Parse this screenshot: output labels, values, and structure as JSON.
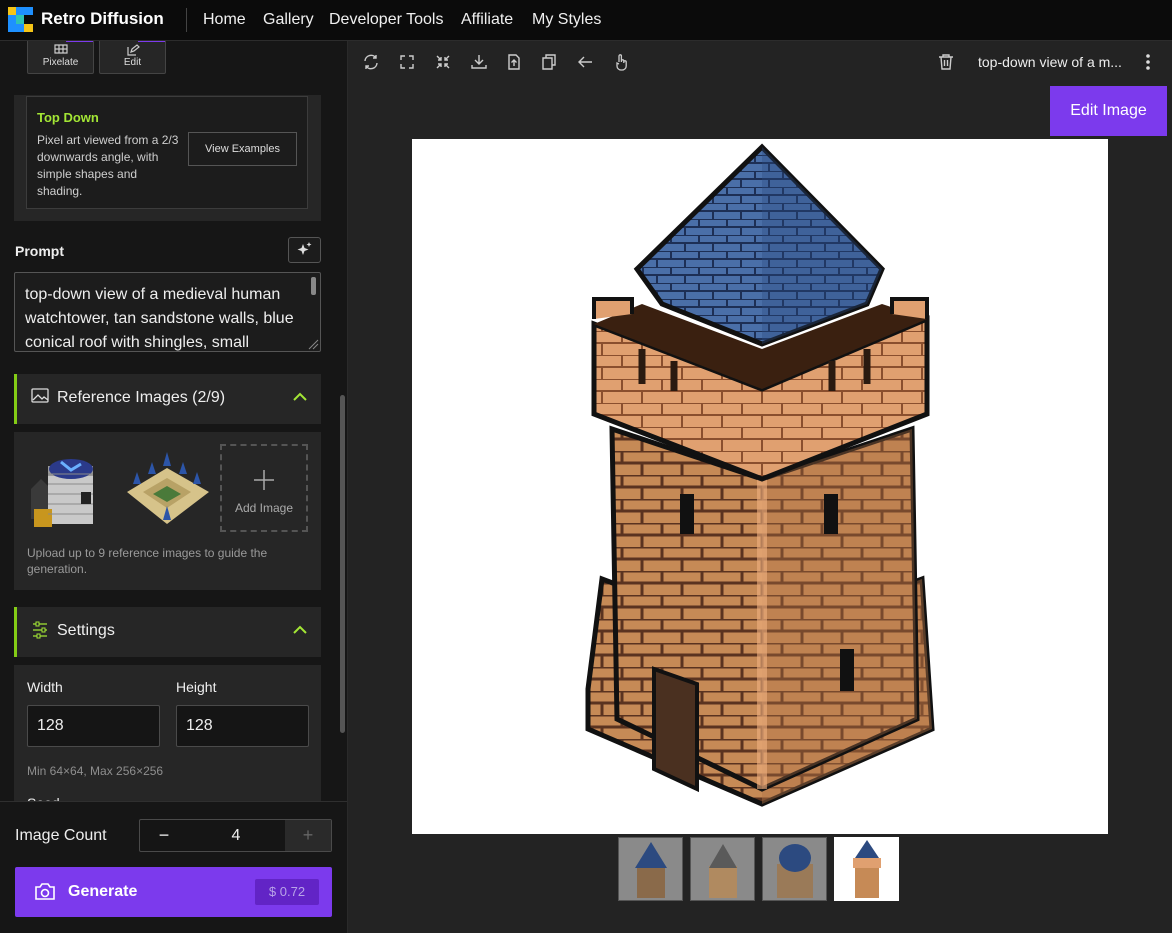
{
  "app": {
    "name": "Retro Diffusion"
  },
  "nav": {
    "items": [
      "Home",
      "Gallery",
      "Developer Tools",
      "Affiliate",
      "My Styles"
    ]
  },
  "tools": {
    "pixelate": "Pixelate",
    "edit": "Edit"
  },
  "style": {
    "title": "Top Down",
    "description": "Pixel art viewed from a 2/3 downwards angle, with simple shapes and shading.",
    "examples_button": "View Examples"
  },
  "prompt": {
    "label": "Prompt",
    "text": "top-down view of a medieval human watchtower, tan sandstone walls, blue conical roof with shingles, small"
  },
  "references": {
    "title": "Reference Images (2/9)",
    "add_label": "Add Image",
    "help": "Upload up to 9 reference images to guide the generation."
  },
  "settings": {
    "title": "Settings",
    "width_label": "Width",
    "width_value": "128",
    "height_label": "Height",
    "height_value": "128",
    "limits": "Min 64×64, Max 256×256",
    "seed_label": "Seed"
  },
  "image_count": {
    "label": "Image Count",
    "value": "4",
    "minus": "−",
    "plus": "+"
  },
  "generate": {
    "label": "Generate",
    "price": "$ 0.72"
  },
  "viewer": {
    "title": "top-down view of a m...",
    "edit_button": "Edit Image"
  },
  "icons": [
    "refresh-icon",
    "expand-icon",
    "shrink-icon",
    "download-icon",
    "upload-icon",
    "copy-icon",
    "back-arrow-icon",
    "pointer-icon",
    "trash-icon",
    "more-vertical-icon"
  ],
  "colors": {
    "accent": "#7c3aed",
    "highlight": "#84cc16",
    "style_title": "#a3e635"
  }
}
